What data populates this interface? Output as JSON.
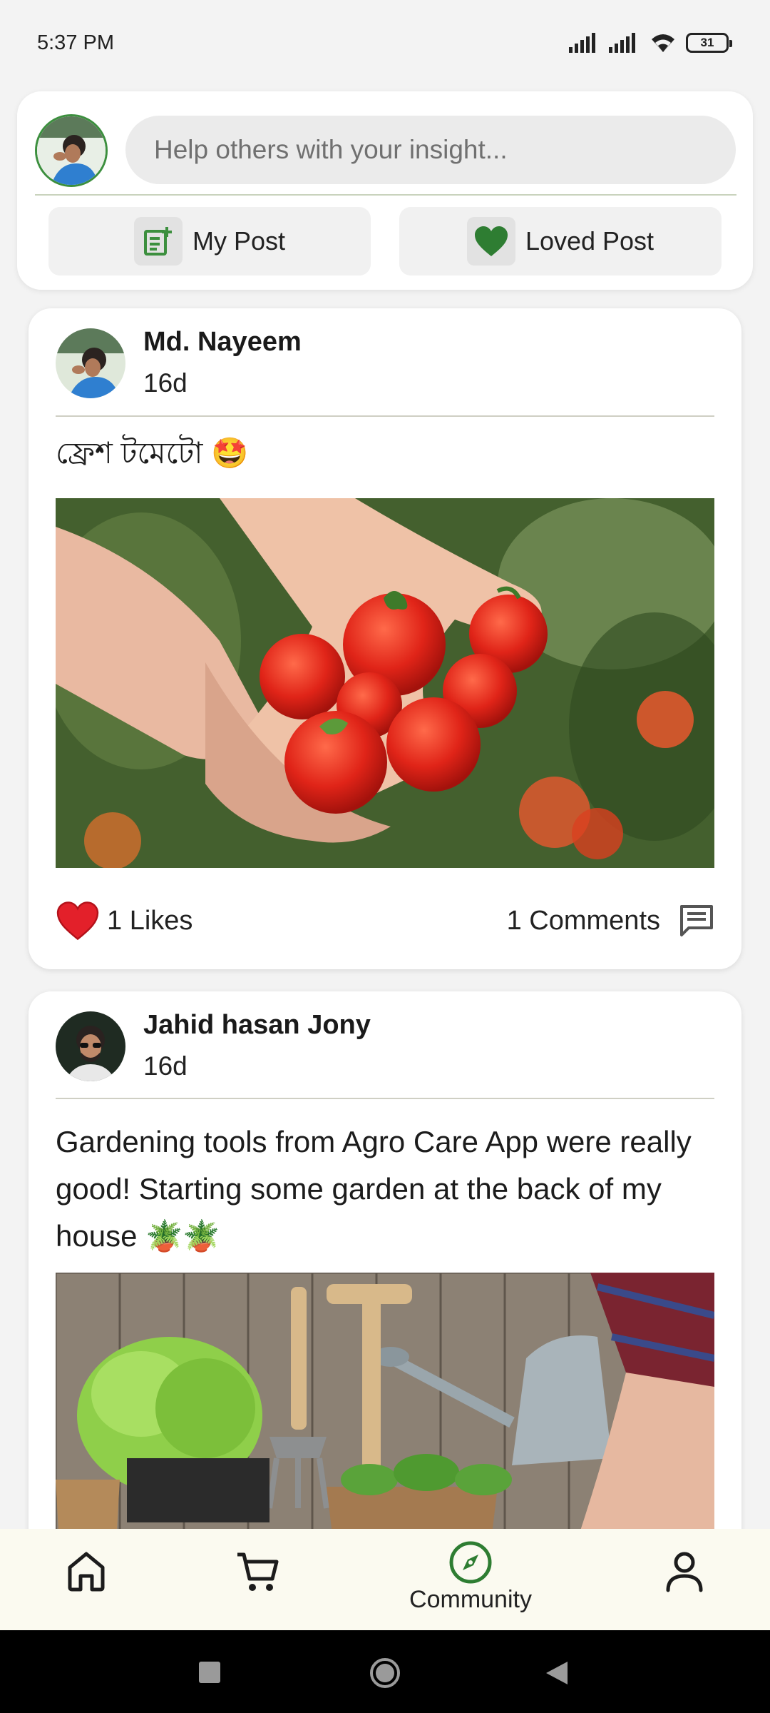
{
  "status_bar": {
    "time": "5:37 PM",
    "battery": "31"
  },
  "composer": {
    "placeholder": "Help others with your insight...",
    "my_post_label": "My Post",
    "loved_post_label": "Loved Post"
  },
  "posts": [
    {
      "author": "Md. Nayeem",
      "time": "16d",
      "text": "ফ্রেশ টমেটো 🤩",
      "likes": "1 Likes",
      "comments": "1 Comments"
    },
    {
      "author": "Jahid hasan Jony",
      "time": "16d",
      "text": "Gardening tools from Agro Care App were really good! Starting some garden at the back of my house 🪴🪴"
    }
  ],
  "bottom_nav": {
    "active_label": "Community"
  },
  "colors": {
    "accent_green": "#3c8f3e",
    "like_red": "#e3202a",
    "nav_bg": "#fbfaf0"
  }
}
